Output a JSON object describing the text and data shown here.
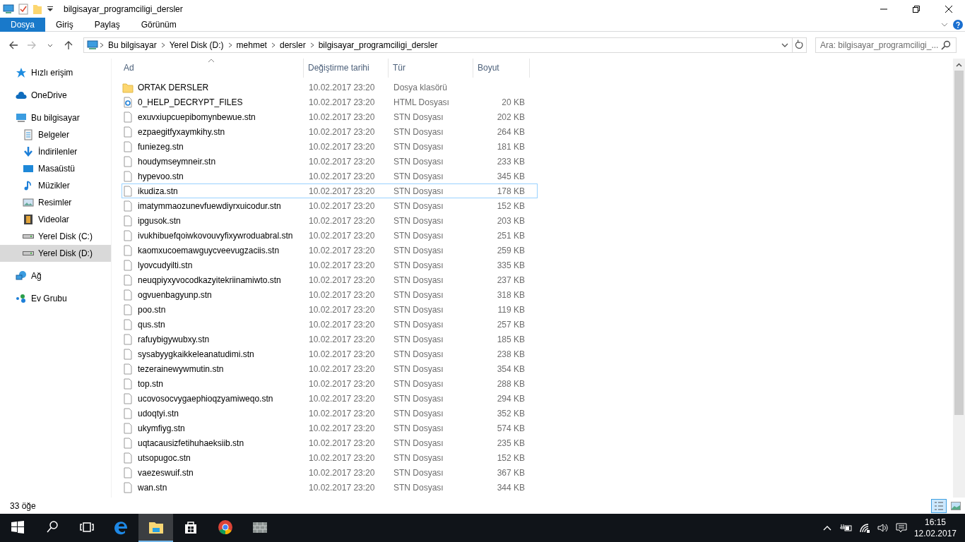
{
  "window": {
    "title": "bilgisayar_programciligi_dersler"
  },
  "ribbon_tabs": [
    {
      "label": "Dosya",
      "selected": true
    },
    {
      "label": "Giriş",
      "selected": false
    },
    {
      "label": "Paylaş",
      "selected": false
    },
    {
      "label": "Görünüm",
      "selected": false
    }
  ],
  "address": {
    "path": [
      "Bu bilgisayar",
      "Yerel Disk (D:)",
      "mehmet",
      "dersler",
      "bilgisayar_programciligi_dersler"
    ]
  },
  "search": {
    "placeholder": "Ara: bilgisayar_programciligi_..."
  },
  "sidebar": {
    "items": [
      {
        "label": "Hızlı erişim",
        "kind": "star",
        "selected": false
      },
      {
        "label": "OneDrive",
        "kind": "cloud",
        "selected": false
      },
      {
        "label": "Bu bilgisayar",
        "kind": "pc",
        "selected": false,
        "children": [
          {
            "label": "Belgeler",
            "kind": "doc",
            "selected": false
          },
          {
            "label": "İndirilenler",
            "kind": "down",
            "selected": false
          },
          {
            "label": "Masaüstü",
            "kind": "desktop",
            "selected": false
          },
          {
            "label": "Müzikler",
            "kind": "music",
            "selected": false
          },
          {
            "label": "Resimler",
            "kind": "pictures",
            "selected": false
          },
          {
            "label": "Videolar",
            "kind": "video",
            "selected": false
          },
          {
            "label": "Yerel Disk (C:)",
            "kind": "drive",
            "selected": false
          },
          {
            "label": "Yerel Disk (D:)",
            "kind": "drive",
            "selected": true
          }
        ]
      },
      {
        "label": "Ağ",
        "kind": "network",
        "selected": false
      },
      {
        "label": "Ev Grubu",
        "kind": "homegroup",
        "selected": false
      }
    ]
  },
  "table": {
    "columns": [
      "Ad",
      "Değiştirme tarihi",
      "Tür",
      "Boyut"
    ],
    "rows": [
      {
        "kind": "folder",
        "name": "ORTAK DERSLER",
        "date": "10.02.2017 23:20",
        "type": "Dosya klasörü",
        "focused": false
      },
      {
        "kind": "html",
        "name": "0_HELP_DECRYPT_FILES",
        "date": "10.02.2017 23:20",
        "type": "HTML Dosyası",
        "size": "20 KB",
        "focused": false
      },
      {
        "kind": "file",
        "name": "exuvxiupcuepibomynbewue.stn",
        "date": "10.02.2017 23:20",
        "type": "STN Dosyası",
        "size": "202 KB",
        "focused": false
      },
      {
        "kind": "file",
        "name": "ezpaegitfyxaymkihy.stn",
        "date": "10.02.2017 23:20",
        "type": "STN Dosyası",
        "size": "264 KB",
        "focused": false
      },
      {
        "kind": "file",
        "name": "funiezeg.stn",
        "date": "10.02.2017 23:20",
        "type": "STN Dosyası",
        "size": "181 KB",
        "focused": false
      },
      {
        "kind": "file",
        "name": "houdymseymneir.stn",
        "date": "10.02.2017 23:20",
        "type": "STN Dosyası",
        "size": "233 KB",
        "focused": false
      },
      {
        "kind": "file",
        "name": "hypevoo.stn",
        "date": "10.02.2017 23:20",
        "type": "STN Dosyası",
        "size": "345 KB",
        "focused": false
      },
      {
        "kind": "file",
        "name": "ikudiza.stn",
        "date": "10.02.2017 23:20",
        "type": "STN Dosyası",
        "size": "178 KB",
        "focused": true
      },
      {
        "kind": "file",
        "name": "imatymmaozunevfuewdiyrxuicodur.stn",
        "date": "10.02.2017 23:20",
        "type": "STN Dosyası",
        "size": "152 KB",
        "focused": false
      },
      {
        "kind": "file",
        "name": "ipgusok.stn",
        "date": "10.02.2017 23:20",
        "type": "STN Dosyası",
        "size": "203 KB",
        "focused": false
      },
      {
        "kind": "file",
        "name": "ivukhibuefqoiwkovouvyfixywroduabral.stn",
        "date": "10.02.2017 23:20",
        "type": "STN Dosyası",
        "size": "251 KB",
        "focused": false
      },
      {
        "kind": "file",
        "name": "kaomxucoemawguycveevugzaciis.stn",
        "date": "10.02.2017 23:20",
        "type": "STN Dosyası",
        "size": "259 KB",
        "focused": false
      },
      {
        "kind": "file",
        "name": "lyovcudyilti.stn",
        "date": "10.02.2017 23:20",
        "type": "STN Dosyası",
        "size": "335 KB",
        "focused": false
      },
      {
        "kind": "file",
        "name": "neuqpiyxyvocodkazyitekriinamiwto.stn",
        "date": "10.02.2017 23:20",
        "type": "STN Dosyası",
        "size": "237 KB",
        "focused": false
      },
      {
        "kind": "file",
        "name": "ogvuenbagyunp.stn",
        "date": "10.02.2017 23:20",
        "type": "STN Dosyası",
        "size": "318 KB",
        "focused": false
      },
      {
        "kind": "file",
        "name": "poo.stn",
        "date": "10.02.2017 23:20",
        "type": "STN Dosyası",
        "size": "119 KB",
        "focused": false
      },
      {
        "kind": "file",
        "name": "qus.stn",
        "date": "10.02.2017 23:20",
        "type": "STN Dosyası",
        "size": "257 KB",
        "focused": false
      },
      {
        "kind": "file",
        "name": "rafuybigywubxy.stn",
        "date": "10.02.2017 23:20",
        "type": "STN Dosyası",
        "size": "185 KB",
        "focused": false
      },
      {
        "kind": "file",
        "name": "sysabyygkaikkeleanatudimi.stn",
        "date": "10.02.2017 23:20",
        "type": "STN Dosyası",
        "size": "238 KB",
        "focused": false
      },
      {
        "kind": "file",
        "name": "tezerainewywmutin.stn",
        "date": "10.02.2017 23:20",
        "type": "STN Dosyası",
        "size": "354 KB",
        "focused": false
      },
      {
        "kind": "file",
        "name": "top.stn",
        "date": "10.02.2017 23:20",
        "type": "STN Dosyası",
        "size": "288 KB",
        "focused": false
      },
      {
        "kind": "file",
        "name": "ucovosocvygaephioqzyamiweqo.stn",
        "date": "10.02.2017 23:20",
        "type": "STN Dosyası",
        "size": "294 KB",
        "focused": false
      },
      {
        "kind": "file",
        "name": "udoqtyi.stn",
        "date": "10.02.2017 23:20",
        "type": "STN Dosyası",
        "size": "352 KB",
        "focused": false
      },
      {
        "kind": "file",
        "name": "ukymfiyg.stn",
        "date": "10.02.2017 23:20",
        "type": "STN Dosyası",
        "size": "574 KB",
        "focused": false
      },
      {
        "kind": "file",
        "name": "uqtacausizfetihuhaeksiib.stn",
        "date": "10.02.2017 23:20",
        "type": "STN Dosyası",
        "size": "235 KB",
        "focused": false
      },
      {
        "kind": "file",
        "name": "utsopugoc.stn",
        "date": "10.02.2017 23:20",
        "type": "STN Dosyası",
        "size": "152 KB",
        "focused": false
      },
      {
        "kind": "file",
        "name": "vaezeswuif.stn",
        "date": "10.02.2017 23:20",
        "type": "STN Dosyası",
        "size": "367 KB",
        "focused": false
      },
      {
        "kind": "file",
        "name": "wan.stn",
        "date": "10.02.2017 23:20",
        "type": "STN Dosyası",
        "size": "344 KB",
        "focused": false
      }
    ]
  },
  "status_bar": {
    "count": "33 öğe"
  },
  "taskbar": {
    "apps": [
      {
        "kind": "edge",
        "selected": false
      },
      {
        "kind": "explorer",
        "selected": true
      },
      {
        "kind": "store",
        "selected": false
      },
      {
        "kind": "chrome",
        "selected": false
      },
      {
        "kind": "wall",
        "selected": false
      }
    ],
    "clock": {
      "time": "16:15",
      "date": "12.02.2017"
    }
  }
}
